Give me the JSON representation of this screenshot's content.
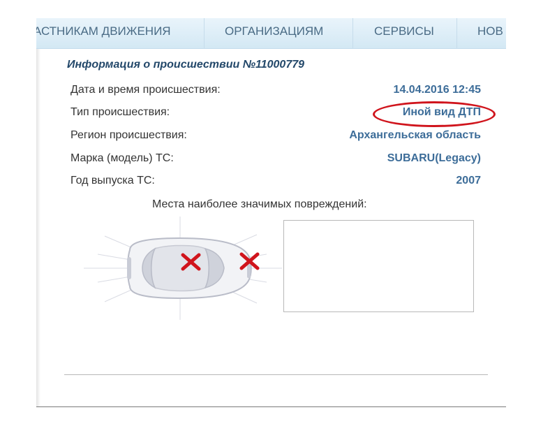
{
  "nav": {
    "items": [
      "АСТНИКАМ ДВИЖЕНИЯ",
      "ОРГАНИЗАЦИЯМ",
      "СЕРВИСЫ",
      "НОВ"
    ]
  },
  "incident": {
    "title": "Информация о происшествии №11000779",
    "rows": [
      {
        "label": "Дата и время происшествия:",
        "value": "14.04.2016 12:45"
      },
      {
        "label": "Тип происшествия:",
        "value": "Иной вид ДТП"
      },
      {
        "label": "Регион происшествия:",
        "value": "Архангельская область"
      },
      {
        "label": "Марка (модель) ТС:",
        "value": "SUBARU(Legacy)"
      },
      {
        "label": "Год выпуска ТС:",
        "value": "2007"
      }
    ],
    "highlighted_row": 1,
    "highlight_color": "#d0141c"
  },
  "damage": {
    "heading": "Места наиболее значимых повреждений:",
    "marked_areas": [
      "front-left",
      "rear-left"
    ],
    "marker_color": "#d0141c",
    "icon": "car-top-view-icon"
  },
  "colors": {
    "nav_bg": "#dcedf7",
    "title": "#23486a",
    "value": "#3d6d99"
  }
}
